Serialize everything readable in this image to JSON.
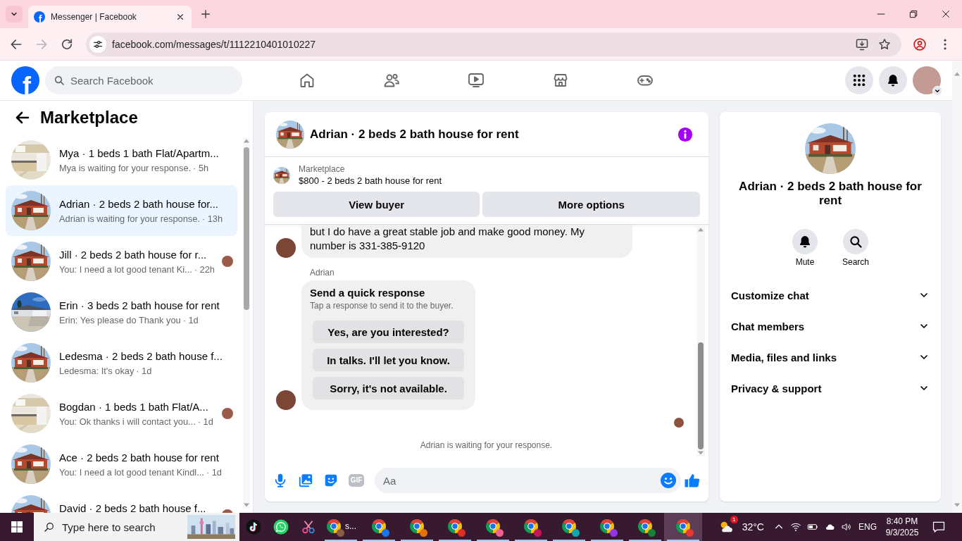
{
  "browser": {
    "tab": {
      "favicon": "f",
      "title": "Messenger | Facebook"
    },
    "nav_buttons": [
      {
        "kind": "back",
        "disabled": false
      },
      {
        "kind": "forward",
        "disabled": true
      },
      {
        "kind": "reload",
        "disabled": false
      }
    ],
    "url": "facebook.com/messages/t/1112210401010227"
  },
  "header": {
    "logo": "f",
    "search": {
      "placeholder": "Search Facebook"
    },
    "nav": [
      {
        "kind": "home",
        "selected": false
      },
      {
        "kind": "friends",
        "selected": false
      },
      {
        "kind": "video",
        "selected": false
      },
      {
        "kind": "marketplace",
        "selected": false
      },
      {
        "kind": "gaming",
        "selected": false
      }
    ]
  },
  "sidebar": {
    "title": "Marketplace",
    "conversations": [
      {
        "thumbnail": {
          "kind": "kitchen"
        },
        "name": "Mya · 1 beds 1 bath Flat/Apartm...",
        "preview": "Mya is waiting for your response.",
        "time": "· 5h",
        "seen": false,
        "selected": false
      },
      {
        "thumbnail": {
          "kind": "red-house"
        },
        "name": "Adrian · 2 beds 2 bath house for...",
        "preview": "Adrian is waiting for your response.",
        "time": "· 13h",
        "seen": false,
        "selected": true
      },
      {
        "thumbnail": {
          "kind": "red-house"
        },
        "name": "Jill · 2 beds 2 bath house for r...",
        "preview": "You: I need a lot good tenant Ki...",
        "time": "· 22h",
        "seen": true,
        "selected": false
      },
      {
        "thumbnail": {
          "kind": "grey-house"
        },
        "name": "Erin · 3 beds 2 bath house for rent",
        "preview": "Erin: Yes please do Thank you",
        "time": "· 1d",
        "seen": false,
        "selected": false
      },
      {
        "thumbnail": {
          "kind": "red-house"
        },
        "name": "Ledesma · 2 beds 2 bath house f...",
        "preview": "Ledesma: It's okay",
        "time": "· 1d",
        "seen": false,
        "selected": false
      },
      {
        "thumbnail": {
          "kind": "kitchen"
        },
        "name": "Bogdan · 1 beds 1 bath Flat/A...",
        "preview": "You: Ok thanks i will contact you...",
        "time": "· 1d",
        "seen": true,
        "selected": false
      },
      {
        "thumbnail": {
          "kind": "red-house"
        },
        "name": "Ace · 2 beds 2 bath house for rent",
        "preview": "You: I need a lot good tenant Kindl...",
        "time": "· 1d",
        "seen": false,
        "selected": false
      },
      {
        "thumbnail": {
          "kind": "red-house"
        },
        "name": "David · 2 beds 2 bath house f...",
        "seen": true,
        "selected": false
      }
    ]
  },
  "chat": {
    "thumbnail": {
      "kind": "red-house"
    },
    "title": "Adrian · 2 beds 2 bath house for rent",
    "listing": {
      "thumbnail": {
        "kind": "red-house"
      },
      "label": "Marketplace",
      "title": "$800 - 2 beds 2 bath house for rent"
    },
    "actions": [
      "View buyer",
      "More options"
    ],
    "messages": [
      {
        "kind": "text",
        "text": "but I do have a great stable job and make good money. My number is 331-385-9120"
      },
      {
        "kind": "quick_responses",
        "sender": "Adrian",
        "title": "Send a quick response",
        "subtitle": "Tap a response to send it to the buyer.",
        "options": [
          "Yes, are you interested?",
          "In talks. I'll let you know.",
          "Sorry, it's not available."
        ]
      }
    ],
    "seen": true,
    "status": "Adrian is waiting for your response.",
    "composer": {
      "tools": [
        {
          "kind": "microphone",
          "disabled": false
        },
        {
          "kind": "photos",
          "disabled": false
        },
        {
          "kind": "sticker",
          "disabled": false
        },
        {
          "kind": "gif",
          "label": "GIF",
          "disabled": true
        }
      ],
      "placeholder": "Aa"
    }
  },
  "details": {
    "thumbnail": {
      "kind": "red-house"
    },
    "title": "Adrian · 2 beds 2 bath house for rent",
    "actions": [
      {
        "kind": "mute",
        "label": "Mute"
      },
      {
        "kind": "search",
        "label": "Search"
      }
    ],
    "sections": [
      {
        "label": "Customize chat",
        "expanded": false
      },
      {
        "label": "Chat members",
        "expanded": false
      },
      {
        "label": "Media, files and links",
        "expanded": false
      },
      {
        "label": "Privacy & support",
        "expanded": false
      }
    ]
  },
  "taskbar": {
    "search": {
      "placeholder": "Type here to search"
    },
    "apps": [
      {
        "kind": "tiktok",
        "running": false,
        "selected": false
      },
      {
        "kind": "whatsapp",
        "running": false,
        "selected": false
      },
      {
        "kind": "scissors",
        "running": false,
        "selected": false
      },
      {
        "kind": "chrome",
        "label": "s...",
        "color": "#8a5a48",
        "running": true,
        "selected": false
      },
      {
        "kind": "chrome",
        "color": "#1a73e8",
        "running": true,
        "selected": false
      },
      {
        "kind": "chrome",
        "color": "#e8710a",
        "running": true,
        "selected": false
      },
      {
        "kind": "chrome",
        "color": "#d93025",
        "running": true,
        "selected": false
      },
      {
        "kind": "chrome",
        "color": "#f06292",
        "running": true,
        "selected": false
      },
      {
        "kind": "chrome",
        "color": "#c2185b",
        "running": true,
        "selected": false
      },
      {
        "kind": "chrome",
        "color": "#12a4af",
        "running": true,
        "selected": false
      },
      {
        "kind": "chrome",
        "color": "#9334e6",
        "running": true,
        "selected": false
      },
      {
        "kind": "chrome",
        "color": "#188038",
        "running": true,
        "selected": false
      },
      {
        "kind": "chrome",
        "color": "#e53935",
        "running": true,
        "selected": true
      }
    ],
    "weather": {
      "badge": "1",
      "temperature": "32°C"
    },
    "language": "ENG",
    "time": "8:40 PM",
    "date": "9/3/2025"
  }
}
